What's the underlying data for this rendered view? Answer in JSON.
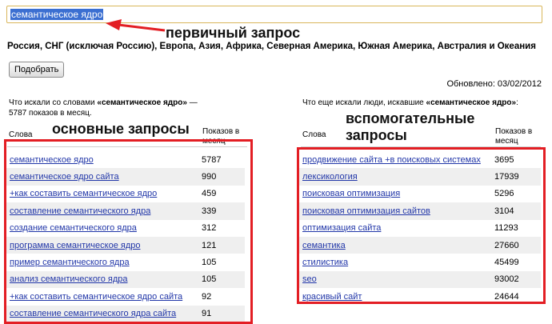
{
  "search": {
    "value": "семантическое ядро"
  },
  "regions": "Россия, СНГ (исключая Россию), Европа, Азия, Африка, Северная Америка, Южная Америка, Австралия и Океания",
  "pick_button": "Подобрать",
  "updated": "Обновлено: 03/02/2012",
  "annotations": {
    "primary": "первичный запрос",
    "main": "основные запросы",
    "aux_line1": "вспомогательные",
    "aux_line2": "запросы"
  },
  "left": {
    "desc_prefix": "Что искали со словами ",
    "desc_bold": "«семантическое ядро»",
    "desc_suffix": " — 5787 показов в месяц.",
    "col_words": "Слова",
    "col_shows": "Показов в месяц",
    "rows": [
      {
        "phrase": "семантическое ядро",
        "count": "5787"
      },
      {
        "phrase": "семантическое ядро сайта",
        "count": "990"
      },
      {
        "phrase": "+как составить семантическое ядро",
        "count": "459"
      },
      {
        "phrase": "составление семантического ядра",
        "count": "339"
      },
      {
        "phrase": "создание семантического ядра",
        "count": "312"
      },
      {
        "phrase": "программа семантическое ядро",
        "count": "121"
      },
      {
        "phrase": "пример семантического ядра",
        "count": "105"
      },
      {
        "phrase": "анализ семантического ядра",
        "count": "105"
      },
      {
        "phrase": "+как составить семантическое ядро сайта",
        "count": "92"
      },
      {
        "phrase": "составление семантического ядра сайта",
        "count": "91"
      }
    ]
  },
  "right": {
    "desc_prefix": "Что еще искали люди, искавшие ",
    "desc_bold": "«семантическое ядро»",
    "desc_suffix": ":",
    "col_words": "Слова",
    "col_shows": "Показов в месяц",
    "rows": [
      {
        "phrase": "продвижение сайта +в поисковых системах",
        "count": "3695"
      },
      {
        "phrase": "лексикология",
        "count": "17939"
      },
      {
        "phrase": "поисковая оптимизация",
        "count": "5296"
      },
      {
        "phrase": "поисковая оптимизация сайтов",
        "count": "3104"
      },
      {
        "phrase": "оптимизация сайта",
        "count": "11293"
      },
      {
        "phrase": "семантика",
        "count": "27660"
      },
      {
        "phrase": "стилистика",
        "count": "45499"
      },
      {
        "phrase": "seo",
        "count": "93002"
      },
      {
        "phrase": "красивый сайт",
        "count": "24644"
      }
    ]
  },
  "colors": {
    "link": "#2136a8",
    "highlight_box": "#e31e24",
    "arrow": "#e31e24",
    "row_alt": "#efefef"
  }
}
